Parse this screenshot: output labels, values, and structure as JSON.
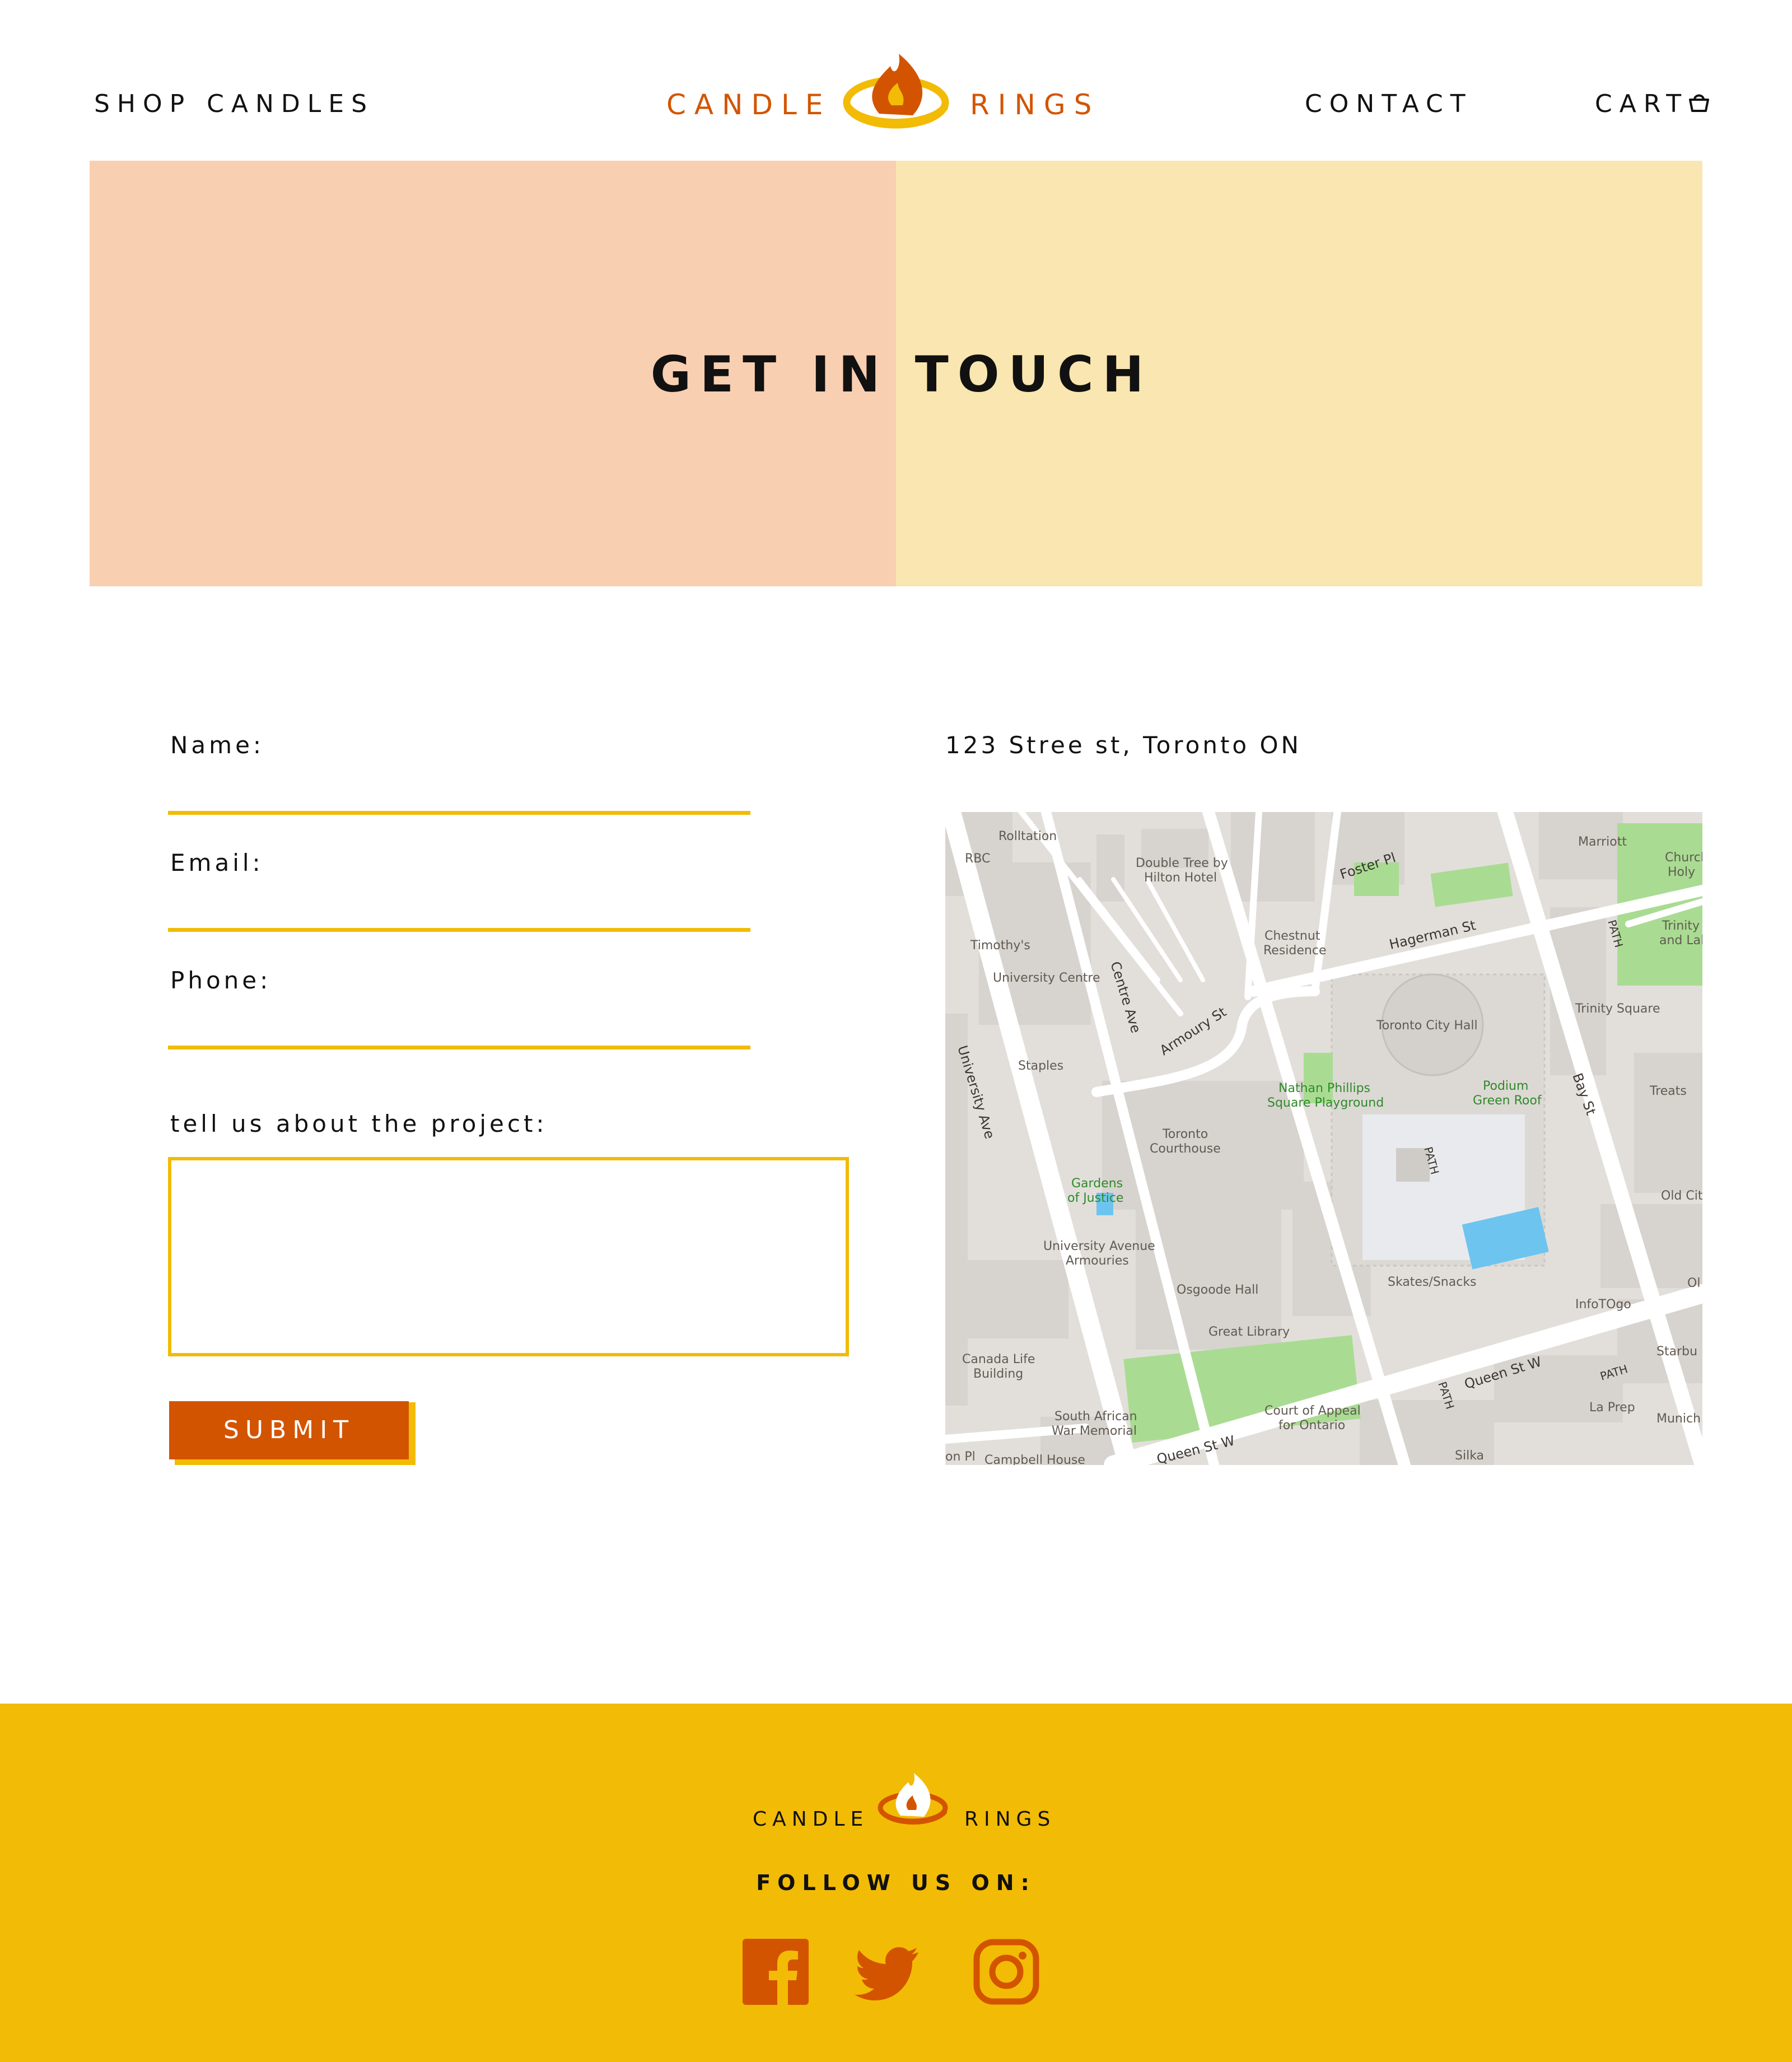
{
  "header": {
    "shop_label": "SHOP CANDLES",
    "contact_label": "CONTACT",
    "cart_label": "CART",
    "logo_left": "CANDLE",
    "logo_right": "RINGS"
  },
  "hero": {
    "title": "GET IN TOUCH",
    "left_color": "#f9cfb2",
    "right_color": "#f9e6b0"
  },
  "form": {
    "name_label": "Name:",
    "email_label": "Email:",
    "phone_label": "Phone:",
    "project_label": "tell us about the project:",
    "submit_label": "SUBMIT"
  },
  "location": {
    "address": "123 Stree st, Toronto ON",
    "map_labels": {
      "rolltation": "Rolltation",
      "rbc": "RBC",
      "doubletree_1": "Double Tree by",
      "doubletree_2": "Hilton Hotel",
      "foster": "Foster Pl",
      "marriott": "Marriott",
      "church_1": "Church",
      "church_2": "Holy",
      "trinity_park_1": "Trinity Park",
      "trinity_park_2": "and Labyrinth",
      "timothys": "Timothy's",
      "university_centre": "University Centre",
      "chestnut_1": "Chestnut",
      "chestnut_2": "Residence",
      "hagerman": "Hagerman St",
      "path_1": "PATH",
      "centre_ave": "Centre Ave",
      "armoury": "Armoury St",
      "city_hall": "Toronto City Hall",
      "trinity_square": "Trinity Square",
      "university_ave": "University Ave",
      "staples": "Staples",
      "nathan_1": "Nathan Phillips",
      "nathan_2": "Square Playground",
      "podium_1": "Podium",
      "podium_2": "Green Roof",
      "bay": "Bay St",
      "treats": "Treats",
      "courthouse_1": "Toronto",
      "courthouse_2": "Courthouse",
      "path_2": "PATH",
      "gardens_1": "Gardens",
      "gardens_2": "of Justice",
      "old_city": "Old City",
      "armouries_1": "University Avenue",
      "armouries_2": "Armouries",
      "osgoode": "Osgoode Hall",
      "skates": "Skates/Snacks",
      "infotogo": "InfoTOgo",
      "ol": "Ol",
      "great_library": "Great Library",
      "canada_life_1": "Canada Life",
      "canada_life_2": "Building",
      "queen_1": "Queen St W",
      "starbucks": "Starbu",
      "path_3": "PATH",
      "court_1": "Court of Appeal",
      "court_2": "for Ontario",
      "path_4": "PATH",
      "la_prep": "La Prep",
      "sa_war_1": "South African",
      "sa_war_2": "War Memorial",
      "munich": "Munich R",
      "on_pl": "on Pl",
      "queen_2": "Queen St W",
      "campbell": "Campbell House",
      "silka": "Silka"
    }
  },
  "footer": {
    "logo_left": "CANDLE",
    "logo_right": "RINGS",
    "follow_label": "FOLLOW US ON:"
  },
  "colors": {
    "accent_orange": "#d35400",
    "accent_yellow": "#f2bb05"
  },
  "icons": {
    "cart": "basket-icon",
    "logo_mark": "flame-ring-icon",
    "facebook": "facebook-icon",
    "twitter": "twitter-icon",
    "instagram": "instagram-icon"
  }
}
